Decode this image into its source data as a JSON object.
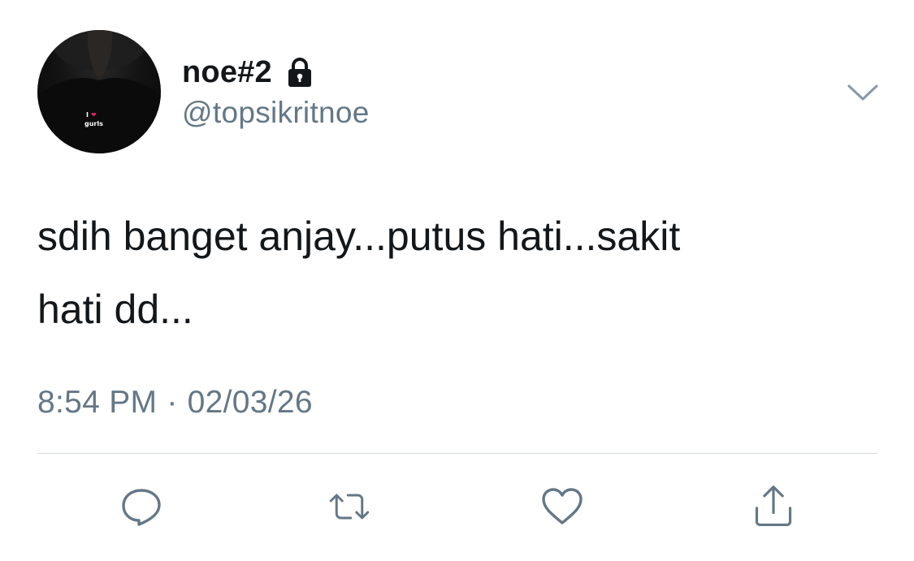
{
  "tweet": {
    "display_name": "noe#2",
    "handle": "@topsikritnoe",
    "text": "sdih banget anjay...putus hati...sakit\nhati dd...",
    "time": "8:54 PM",
    "separator": "·",
    "date": "02/03/26",
    "avatar_shirt_text": [
      "I",
      "❤",
      "gurls"
    ]
  },
  "icons": {
    "protected": "lock-icon",
    "more": "chevron-down-icon",
    "reply": "reply-icon",
    "retweet": "retweet-icon",
    "like": "heart-icon",
    "share": "share-icon"
  },
  "colors": {
    "primary_text": "#14171a",
    "secondary_text": "#657786",
    "divider": "#d6dbe0",
    "background": "#ffffff"
  }
}
